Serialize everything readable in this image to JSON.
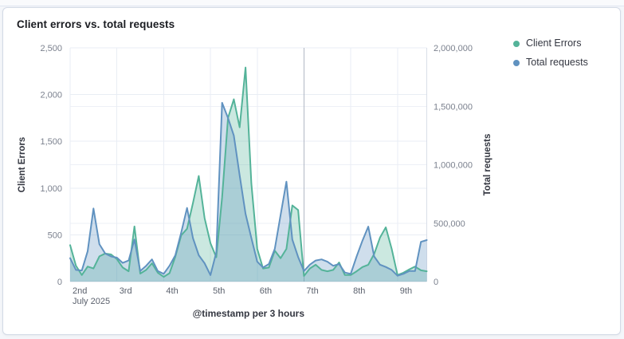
{
  "card": {
    "title": "Client errors vs. total requests"
  },
  "legend": {
    "items": [
      {
        "label": "Client Errors",
        "color": "#54B399"
      },
      {
        "label": "Total requests",
        "color": "#6092C0"
      }
    ]
  },
  "chart_data": {
    "type": "area",
    "title": "Client errors vs. total requests",
    "fill_opacity": 0.3,
    "grid": true,
    "legend_position": "right",
    "x_axis": {
      "title": "@timestamp per 3 hours",
      "start": "2025-07-02T00:00",
      "interval_hours": 3,
      "tick_labels": [
        "2nd",
        "3rd",
        "4th",
        "5th",
        "6th",
        "7th",
        "8th",
        "9th"
      ],
      "context_label": "July 2025",
      "emphasized_tick_index": 5
    },
    "y_axis_left": {
      "title": "Client Errors",
      "min": 0,
      "max": 2500,
      "tick_values": [
        0,
        500,
        1000,
        1500,
        2000,
        2500
      ],
      "ticks": [
        "0",
        "500",
        "1,000",
        "1,500",
        "2,000",
        "2,500"
      ]
    },
    "y_axis_right": {
      "title": "Total requests",
      "min": 0,
      "max": 2000000,
      "tick_values": [
        0,
        500000,
        1000000,
        1500000,
        2000000
      ],
      "ticks": [
        "0",
        "500,000",
        "1,000,000",
        "1,500,000",
        "2,000,000"
      ]
    },
    "series": [
      {
        "name": "Client Errors",
        "axis": "left",
        "color": "#54B399",
        "values": [
          390,
          170,
          70,
          160,
          140,
          270,
          300,
          290,
          240,
          150,
          110,
          590,
          85,
          125,
          195,
          95,
          50,
          90,
          265,
          495,
          565,
          840,
          1130,
          680,
          410,
          260,
          900,
          1750,
          1950,
          1650,
          2290,
          1050,
          350,
          140,
          150,
          330,
          250,
          350,
          815,
          765,
          60,
          140,
          180,
          125,
          110,
          125,
          205,
          70,
          70,
          110,
          155,
          180,
          295,
          470,
          580,
          350,
          70,
          95,
          130,
          160,
          120,
          110
        ]
      },
      {
        "name": "Total requests",
        "axis": "right",
        "color": "#6092C0",
        "values": [
          200000,
          100000,
          95000,
          260000,
          625000,
          320000,
          240000,
          215000,
          205000,
          160000,
          180000,
          360000,
          90000,
          135000,
          190000,
          90000,
          66000,
          135000,
          225000,
          420000,
          630000,
          373000,
          225000,
          157000,
          55000,
          250000,
          1530000,
          1400000,
          1250000,
          910000,
          580000,
          373000,
          170000,
          120000,
          150000,
          280000,
          570000,
          855000,
          360000,
          210000,
          90000,
          145000,
          180000,
          190000,
          170000,
          135000,
          150000,
          77000,
          66000,
          215000,
          350000,
          470000,
          215000,
          145000,
          125000,
          100000,
          50000,
          66000,
          90000,
          90000,
          340000,
          355000
        ]
      }
    ]
  }
}
